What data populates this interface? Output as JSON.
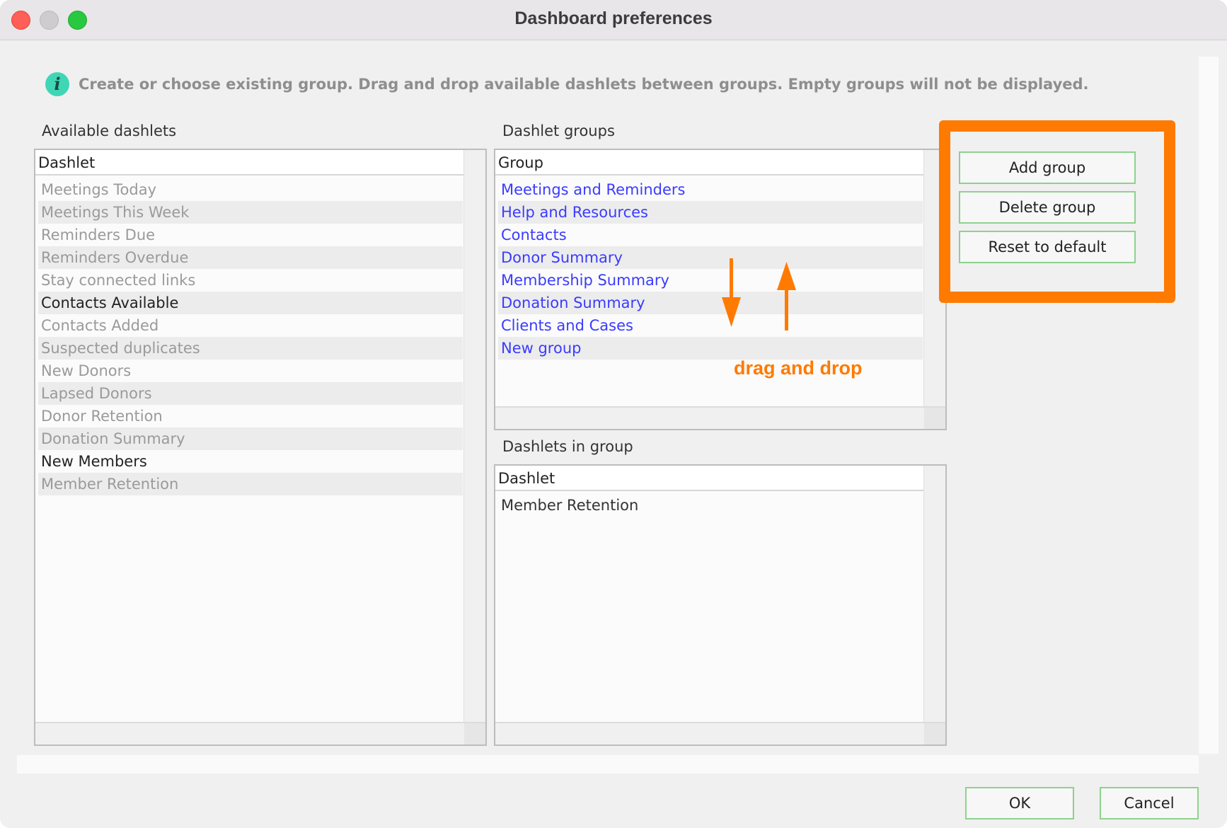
{
  "window": {
    "title": "Dashboard preferences"
  },
  "info": {
    "text": "Create or choose existing group. Drag and drop available dashlets between groups. Empty groups will not be displayed."
  },
  "available": {
    "label": "Available dashlets",
    "column": "Dashlet",
    "items": [
      {
        "label": "Meetings Today",
        "state": "disabled"
      },
      {
        "label": "Meetings This Week",
        "state": "disabled"
      },
      {
        "label": "Reminders Due",
        "state": "disabled"
      },
      {
        "label": "Reminders Overdue",
        "state": "disabled"
      },
      {
        "label": "Stay connected links",
        "state": "disabled"
      },
      {
        "label": "Contacts Available",
        "state": "enabled"
      },
      {
        "label": "Contacts Added",
        "state": "disabled"
      },
      {
        "label": "Suspected duplicates",
        "state": "disabled"
      },
      {
        "label": "New Donors",
        "state": "disabled"
      },
      {
        "label": "Lapsed Donors",
        "state": "disabled"
      },
      {
        "label": "Donor Retention",
        "state": "disabled"
      },
      {
        "label": "Donation Summary",
        "state": "disabled"
      },
      {
        "label": "New Members",
        "state": "enabled"
      },
      {
        "label": "Member Retention",
        "state": "disabled"
      }
    ]
  },
  "groups": {
    "label": "Dashlet groups",
    "column": "Group",
    "items": [
      "Meetings and Reminders",
      "Help and Resources",
      "Contacts",
      "Donor Summary",
      "Membership Summary",
      "Donation Summary",
      "Clients and Cases",
      "New group"
    ]
  },
  "in_group": {
    "label": "Dashlets in group",
    "column": "Dashlet",
    "items": [
      "Member Retention"
    ]
  },
  "buttons": {
    "add_group": "Add group",
    "delete_group": "Delete group",
    "reset": "Reset to default",
    "ok": "OK",
    "cancel": "Cancel"
  },
  "annotation": {
    "text": "drag and drop",
    "color": "#ff7a00"
  },
  "colors": {
    "link": "#3b3bff",
    "disabled": "#9a9a9a",
    "enabled": "#222222",
    "highlight": "#ff7a00"
  },
  "icons": {
    "info": "info-icon"
  }
}
